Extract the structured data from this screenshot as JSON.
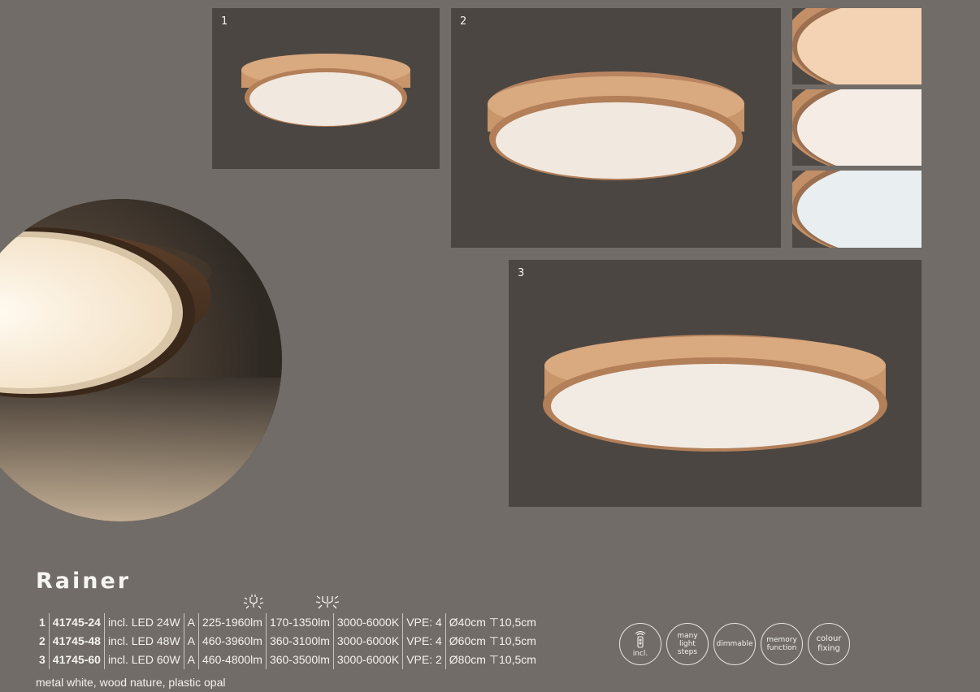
{
  "product": {
    "name": "Rainer",
    "material": "metal white, wood nature, plastic opal"
  },
  "photos": [
    {
      "label": "1"
    },
    {
      "label": "2"
    },
    {
      "label": "3"
    }
  ],
  "spec_icons": [
    "lumen-icon",
    "lumen-real-icon"
  ],
  "specs": [
    {
      "row": "1",
      "code": "41745-24",
      "led": "incl. LED 24W",
      "class": "A",
      "lumen": "225-1960lm",
      "lumen2": "170-1350lm",
      "kelvin": "3000-6000K",
      "vpe": "VPE: 4",
      "size": "Ø40cm",
      "height": "10,5cm"
    },
    {
      "row": "2",
      "code": "41745-48",
      "led": "incl. LED 48W",
      "class": "A",
      "lumen": "460-3960lm",
      "lumen2": "360-3100lm",
      "kelvin": "3000-6000K",
      "vpe": "VPE: 4",
      "size": "Ø60cm",
      "height": "10,5cm"
    },
    {
      "row": "3",
      "code": "41745-60",
      "led": "incl. LED 60W",
      "class": "A",
      "lumen": "460-4800lm",
      "lumen2": "360-3500lm",
      "kelvin": "3000-6000K",
      "vpe": "VPE: 2",
      "size": "Ø80cm",
      "height": "10,5cm"
    }
  ],
  "features": {
    "remote": "incl.",
    "steps_1": "many",
    "steps_2": "light",
    "steps_3": "steps",
    "dimmable": "dimmable",
    "memory_1": "memory",
    "memory_2": "function",
    "colour_1": "colour",
    "colour_2": "fixing"
  },
  "colors": {
    "background": "#716c67",
    "photo_bg": "#4b4641",
    "wood": "#c9956b",
    "diffuser": "#f1e8df"
  }
}
